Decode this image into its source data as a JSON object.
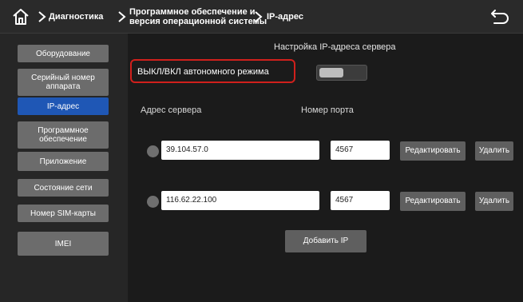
{
  "header": {
    "breadcrumbs": [
      "Диагностика",
      "Программное обеспечение и",
      "версия операционной системы",
      "IP-адрес"
    ]
  },
  "sidebar": {
    "items": [
      {
        "label": "Оборудование",
        "active": false
      },
      {
        "label_line1": "Серийный номер",
        "label_line2": "аппарата",
        "active": false
      },
      {
        "label": "IP-адрес",
        "active": true
      },
      {
        "label_line1": "Программное",
        "label_line2": "обеспечение",
        "active": false
      },
      {
        "label": "Приложение",
        "active": false
      },
      {
        "label": "Состояние сети",
        "active": false
      },
      {
        "label": "Номер SIM-карты",
        "active": false
      },
      {
        "label": "IMEI",
        "active": false
      }
    ]
  },
  "main": {
    "title": "Настройка IP-адреса сервера",
    "mode_toggle_label": "ВЫКЛ/ВКЛ автономного режима",
    "server_address_label": "Адрес сервера",
    "port_label": "Номер порта",
    "rows": [
      {
        "ip": "39.104.57.0",
        "port": "4567",
        "edit": "Редактировать",
        "delete": "Удалить"
      },
      {
        "ip": "116.62.22.100",
        "port": "4567",
        "edit": "Редактировать",
        "delete": "Удалить"
      }
    ],
    "add_ip": "Добавить IP"
  },
  "colors": {
    "active": "#1f57b5",
    "highlight_border": "#d0201c",
    "button": "#5f5f5f"
  }
}
